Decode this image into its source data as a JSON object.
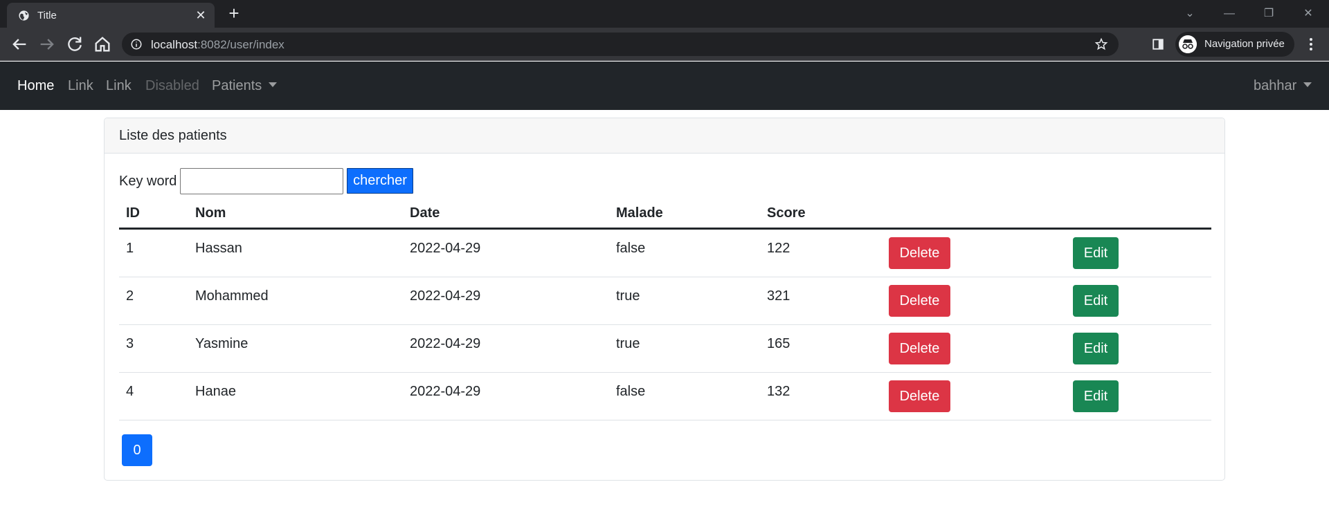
{
  "browser": {
    "tab_title": "Title",
    "url_host": "localhost",
    "url_rest": ":8082/user/index",
    "incognito_label": "Navigation privée"
  },
  "navbar": {
    "links": [
      "Home",
      "Link",
      "Link",
      "Disabled"
    ],
    "dropdown": "Patients",
    "user": "bahhar"
  },
  "card": {
    "title": "Liste des patients",
    "search_label": "Key word",
    "search_value": "",
    "search_button": "chercher"
  },
  "table": {
    "headers": [
      "ID",
      "Nom",
      "Date",
      "Malade",
      "Score"
    ],
    "rows": [
      {
        "id": "1",
        "nom": "Hassan",
        "date": "2022-04-29",
        "malade": "false",
        "score": "122"
      },
      {
        "id": "2",
        "nom": "Mohammed",
        "date": "2022-04-29",
        "malade": "true",
        "score": "321"
      },
      {
        "id": "3",
        "nom": "Yasmine",
        "date": "2022-04-29",
        "malade": "true",
        "score": "165"
      },
      {
        "id": "4",
        "nom": "Hanae",
        "date": "2022-04-29",
        "malade": "false",
        "score": "132"
      }
    ],
    "delete_label": "Delete",
    "edit_label": "Edit"
  },
  "pagination": {
    "pages": [
      "0"
    ]
  },
  "colors": {
    "primary": "#0d6efd",
    "danger": "#dc3545",
    "success": "#198754",
    "navbar": "#212529"
  }
}
